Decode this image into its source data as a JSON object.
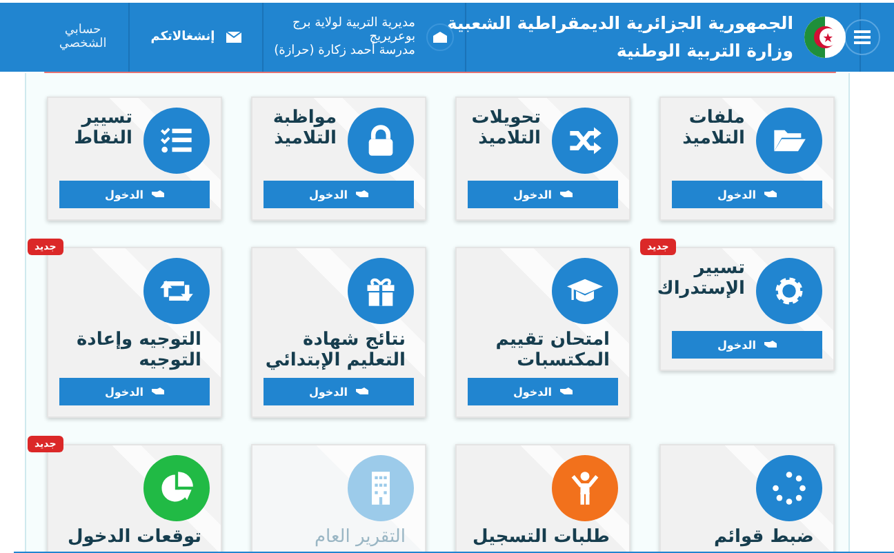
{
  "header": {
    "title_lines": [
      "الجمهورية الجزائرية الديمقراطية الشعبية",
      "وزارة التربية الوطنية"
    ],
    "school_lines": [
      "مديرية التربية لولاية برج",
      "بوعريريج",
      "مدرسة أحمد زكارة (حرازة)"
    ],
    "messages": "إنشغالاتكم",
    "account_lines": [
      "حسابي",
      "الشخصي"
    ]
  },
  "cards": [
    {
      "title_lines": [
        "ملفات",
        "التلاميذ"
      ],
      "kind": "side",
      "color": "#2185d0",
      "new": false,
      "disabled": false,
      "button": "الدخول"
    },
    {
      "title_lines": [
        "تحويلات",
        "التلاميذ"
      ],
      "kind": "side",
      "color": "#2185d0",
      "new": false,
      "disabled": false,
      "button": "الدخول"
    },
    {
      "title_lines": [
        "مواظبة",
        "التلاميذ"
      ],
      "kind": "side",
      "color": "#2185d0",
      "new": false,
      "disabled": false,
      "button": "الدخول"
    },
    {
      "title_lines": [
        "تسيير",
        "النقاط"
      ],
      "kind": "side",
      "color": "#2185d0",
      "new": false,
      "disabled": false,
      "button": "الدخول"
    },
    {
      "title_lines": [
        "تسيير",
        "الإستدراك"
      ],
      "kind": "side",
      "color": "#2185d0",
      "new": true,
      "badge": "جديد",
      "disabled": false,
      "button": "الدخول"
    },
    {
      "title_lines": [
        "امتحان تقييم",
        "المكتسبات"
      ],
      "kind": "stacked",
      "color": "#2185d0",
      "new": false,
      "disabled": false,
      "button": "الدخول"
    },
    {
      "title_lines": [
        "نتائج شهادة",
        "التعليم الإبتدائي"
      ],
      "kind": "stacked",
      "color": "#2185d0",
      "new": false,
      "disabled": false,
      "button": "الدخول"
    },
    {
      "title_lines": [
        "التوجيه وإعادة",
        "التوجيه"
      ],
      "kind": "stacked",
      "color": "#2185d0",
      "new": true,
      "badge": "جديد",
      "disabled": false,
      "button": "الدخول"
    },
    {
      "title_lines": [
        "ضبط قوائم"
      ],
      "kind": "stacked",
      "color": "#2185d0",
      "new": false,
      "disabled": false
    },
    {
      "title_lines": [
        "طلبات التسجيل"
      ],
      "kind": "stacked",
      "color": "#f2711c",
      "new": false,
      "disabled": false
    },
    {
      "title_lines": [
        "التقرير العام"
      ],
      "kind": "stacked",
      "color": "#9ccbea",
      "new": false,
      "disabled": true
    },
    {
      "title_lines": [
        "توقعات الدخول"
      ],
      "kind": "stacked",
      "color": "#21ba45",
      "new": true,
      "badge": "جديد",
      "disabled": false
    }
  ]
}
